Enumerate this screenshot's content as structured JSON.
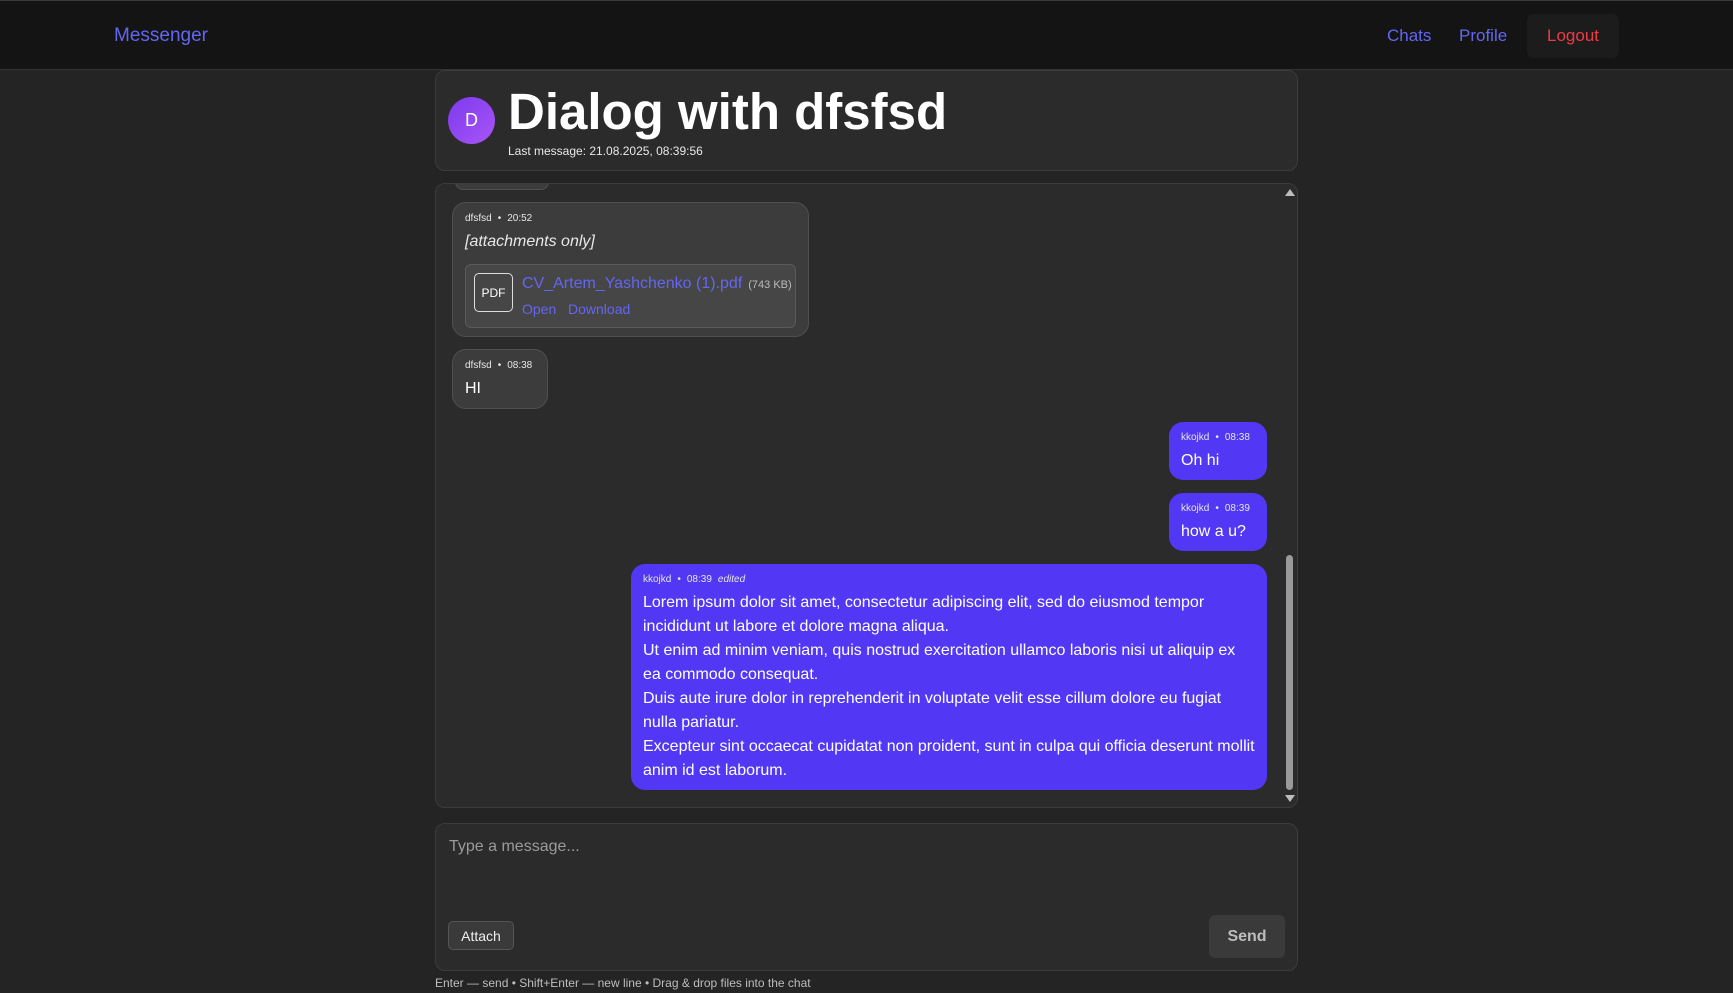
{
  "nav": {
    "brand": "Messenger",
    "chats": "Chats",
    "profile": "Profile",
    "logout": "Logout"
  },
  "dialog": {
    "avatar_letter": "D",
    "title": "Dialog with dfsfsd",
    "last_message": "Last message: 21.08.2025, 08:39:56"
  },
  "messages": [
    {
      "author": "dfsfsd",
      "time": "20:52",
      "text": "[attachments only]",
      "attachment": {
        "icon_label": "PDF",
        "name": "CV_Artem_Yashchenko (1).pdf",
        "size": "(743 KB)",
        "open": "Open",
        "download": "Download"
      }
    },
    {
      "author": "dfsfsd",
      "time": "08:38",
      "text": "HI"
    },
    {
      "author": "kkojkd",
      "time": "08:38",
      "text": "Oh hi"
    },
    {
      "author": "kkojkd",
      "time": "08:39",
      "text": "how a u?"
    },
    {
      "author": "kkojkd",
      "time": "08:39",
      "edited": "edited",
      "text": "Lorem ipsum dolor sit amet, consectetur adipiscing elit, sed do eiusmod tempor incididunt ut labore et dolore magna aliqua.\nUt enim ad minim veniam, quis nostrud exercitation ullamco laboris nisi ut aliquip ex ea commodo consequat.\nDuis aute irure dolor in reprehenderit in voluptate velit esse cillum dolore eu fugiat nulla pariatur.\nExcepteur sint occaecat cupidatat non proident, sunt in culpa qui officia deserunt mollit anim id est laborum."
    }
  ],
  "composer": {
    "placeholder": "Type a message...",
    "attach": "Attach",
    "send": "Send",
    "hint": "Enter — send • Shift+Enter — new line • Drag & drop files into the chat"
  },
  "colors": {
    "accent": "#6366f1",
    "outgoing_bubble": "#5237f4",
    "logout": "#ef3a46"
  }
}
